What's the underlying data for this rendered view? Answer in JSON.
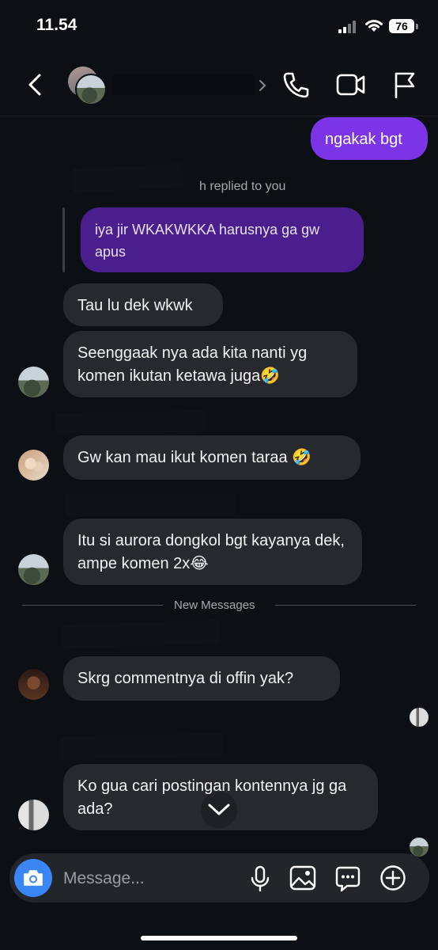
{
  "status": {
    "time": "11.54",
    "battery": "76"
  },
  "header": {
    "contact_name": ""
  },
  "messages": {
    "out_1": "ngakak bgt",
    "reply_label": "h replied to you",
    "quoted_text": "iya jir WKAKWKKA harusnya ga gw apus",
    "in_1": "Tau lu dek wkwk",
    "in_2": "Seenggaak nya ada kita nanti yg komen ikutan ketawa juga🤣",
    "in_3": "Gw kan mau ikut komen taraa 🤣",
    "in_4": "Itu si aurora dongkol bgt kayanya dek, ampe komen 2x😂",
    "divider": "New Messages",
    "in_5": "Skrg commentnya di offin yak?",
    "in_6": "Ko gua cari postingan kontennya jg ga ada?"
  },
  "composer": {
    "placeholder": "Message..."
  },
  "icons": {
    "back": "chevron-left-icon",
    "call": "phone-icon",
    "video": "video-camera-icon",
    "report": "flag-icon",
    "camera": "camera-icon",
    "mic": "microphone-icon",
    "gallery": "image-icon",
    "sticker": "chat-bubble-icon",
    "more": "plus-circle-icon",
    "scroll_down": "chevron-down-icon"
  },
  "colors": {
    "outgoing": "#7b35e6",
    "incoming": "#262a2f",
    "quoted": "#4a1f8d",
    "camera_button": "#3a86f6"
  }
}
